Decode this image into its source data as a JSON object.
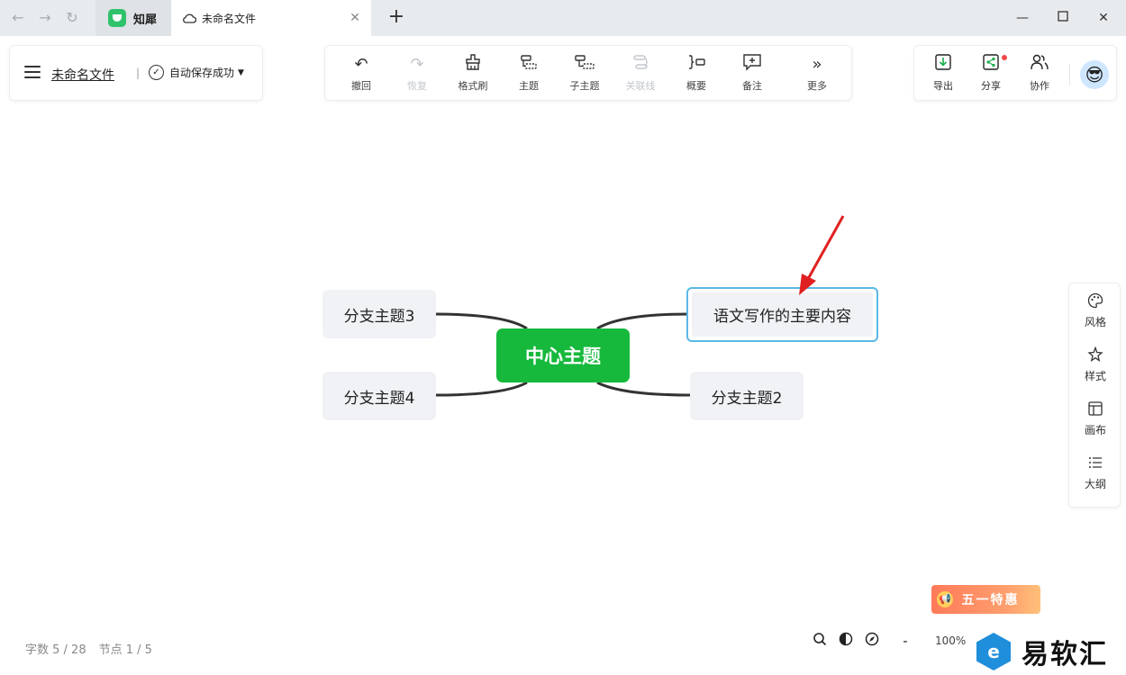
{
  "window": {
    "app_tab": "知犀",
    "file_tab": "未命名文件"
  },
  "file_panel": {
    "file_name": "未命名文件",
    "separator": "|",
    "save_status": "自动保存成功"
  },
  "toolbar": {
    "undo": "撤回",
    "redo": "恢复",
    "format_brush": "格式刷",
    "topic": "主题",
    "subtopic": "子主题",
    "relation": "关联线",
    "summary": "概要",
    "note": "备注",
    "more": "更多"
  },
  "actions": {
    "export": "导出",
    "share": "分享",
    "collab": "协作"
  },
  "side_panel": {
    "style": "风格",
    "look": "样式",
    "canvas": "画布",
    "outline": "大纲"
  },
  "mindmap": {
    "center": "中心主题",
    "branch1": "语文写作的主要内容",
    "branch2": "分支主题2",
    "branch3": "分支主题3",
    "branch4": "分支主题4",
    "center_color": "#16b93c",
    "selection_color": "#5ab8e6"
  },
  "status": {
    "word_count": "字数 5 / 28",
    "node_count": "节点 1 / 5",
    "zoom": "100%",
    "zoom_minus": "-"
  },
  "promo": {
    "text": "五一特惠"
  },
  "watermark": {
    "text": "易软汇"
  }
}
